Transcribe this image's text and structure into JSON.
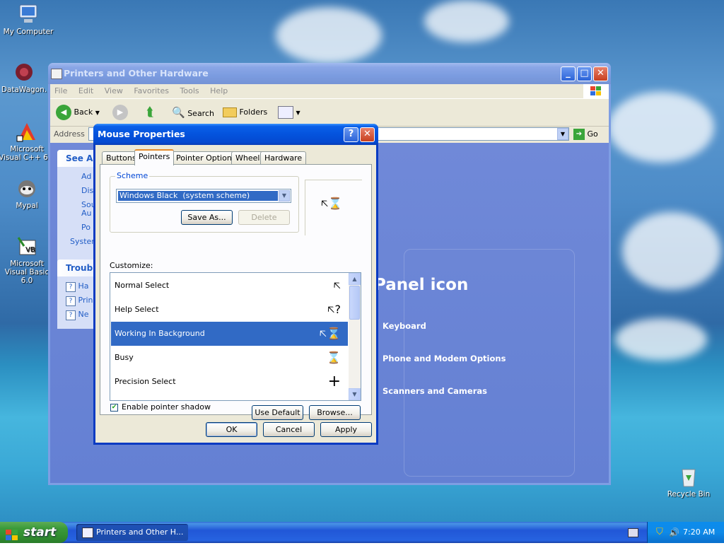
{
  "desktop": {
    "icons": [
      {
        "label": "My Computer"
      },
      {
        "label": "DataWagon."
      },
      {
        "label": "Microsoft Visual C++ 6.0"
      },
      {
        "label": "Mypal"
      },
      {
        "label": "Microsoft Visual Basic 6.0"
      },
      {
        "label": "Recycle Bin"
      }
    ]
  },
  "explorer": {
    "title": "Printers and Other Hardware",
    "menu": [
      "File",
      "Edit",
      "View",
      "Favorites",
      "Tools",
      "Help"
    ],
    "toolbar": {
      "back": "Back",
      "search": "Search",
      "folders": "Folders"
    },
    "address_label": "Address",
    "go_label": "Go",
    "see_also": {
      "header": "See Als",
      "items": [
        "Ad",
        "Dis",
        "Sou",
        "Au",
        "Po",
        "System"
      ]
    },
    "troubleshooters": {
      "header": "Troubl",
      "items": [
        "Ha",
        "Prin",
        "Ne"
      ]
    },
    "panel_heading": "Panel icon",
    "panel_links": [
      "Keyboard",
      "Phone and Modem Options",
      "Scanners and Cameras"
    ]
  },
  "dialog": {
    "title": "Mouse Properties",
    "help_label": "?",
    "close_label": "✕",
    "tabs": [
      "Buttons",
      "Pointers",
      "Pointer Options",
      "Wheel",
      "Hardware"
    ],
    "selected_tab": "Pointers",
    "scheme_label": "Scheme",
    "scheme_value": "Windows Black  (system scheme)",
    "save_as_label": "Save As...",
    "delete_label": "Delete",
    "customize_label": "Customize:",
    "pointers": [
      {
        "name": "Normal Select",
        "glyph": "🡤",
        "selected": false
      },
      {
        "name": "Help Select",
        "glyph": "🡤?",
        "selected": false
      },
      {
        "name": "Working In Background",
        "glyph": "🡤⌛",
        "selected": true
      },
      {
        "name": "Busy",
        "glyph": "⌛",
        "selected": false
      },
      {
        "name": "Precision Select",
        "glyph": "+",
        "selected": false
      }
    ],
    "shadow_label": "Enable pointer shadow",
    "shadow_checked": true,
    "use_default_label": "Use Default",
    "browse_label": "Browse...",
    "ok_label": "OK",
    "cancel_label": "Cancel",
    "apply_label": "Apply"
  },
  "taskbar": {
    "start_label": "start",
    "task_label": "Printers and Other H...",
    "clock": "7:20 AM"
  }
}
